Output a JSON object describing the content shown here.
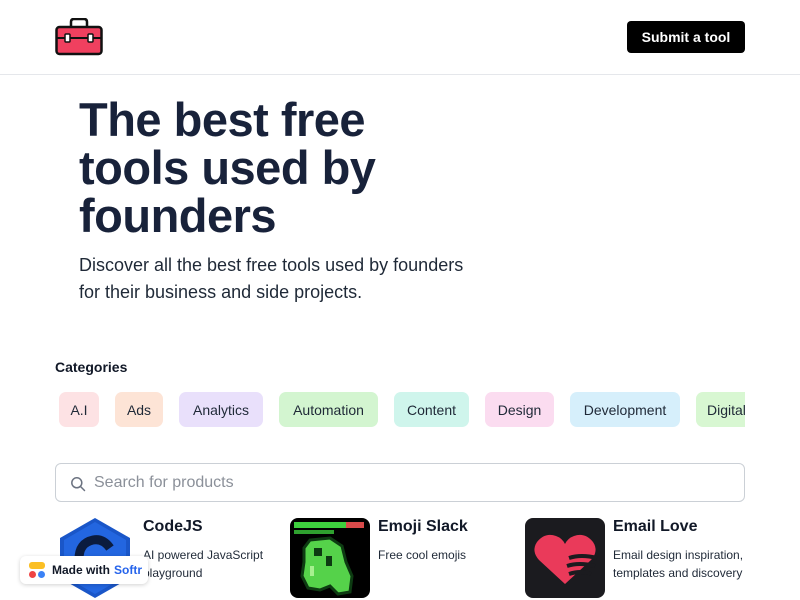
{
  "header": {
    "logo_icon": "toolbox-icon",
    "submit_label": "Submit a tool"
  },
  "hero": {
    "title_lines": [
      "The best free",
      "tools used by",
      "founders"
    ],
    "subtitle_lines": [
      "Discover all the best free tools used by founders",
      "for their business and side projects."
    ]
  },
  "categories": {
    "label": "Categories",
    "items": [
      {
        "label": "A.I",
        "color": "#fde2e4"
      },
      {
        "label": "Ads",
        "color": "#fde4d6"
      },
      {
        "label": "Analytics",
        "color": "#e9e0fb"
      },
      {
        "label": "Automation",
        "color": "#d3f5d0"
      },
      {
        "label": "Content",
        "color": "#cff5ec"
      },
      {
        "label": "Design",
        "color": "#fbdcf0"
      },
      {
        "label": "Development",
        "color": "#d6effb"
      },
      {
        "label": "Digital",
        "color": "#d8f7d2"
      }
    ]
  },
  "search": {
    "placeholder": "Search for products",
    "icon": "search-icon"
  },
  "products": [
    {
      "name": "CodeJS",
      "desc": "AI powered JavaScript playground",
      "icon": "codejs-logo-icon"
    },
    {
      "name": "Emoji Slack",
      "desc": "Free cool emojis",
      "icon": "pixel-blob-icon"
    },
    {
      "name": "Email Love",
      "desc": "Email design inspiration, templates and discovery",
      "icon": "heart-icon"
    }
  ],
  "badge": {
    "prefix": "Made with",
    "brand": "Softr",
    "icon": "softr-logo-icon"
  }
}
